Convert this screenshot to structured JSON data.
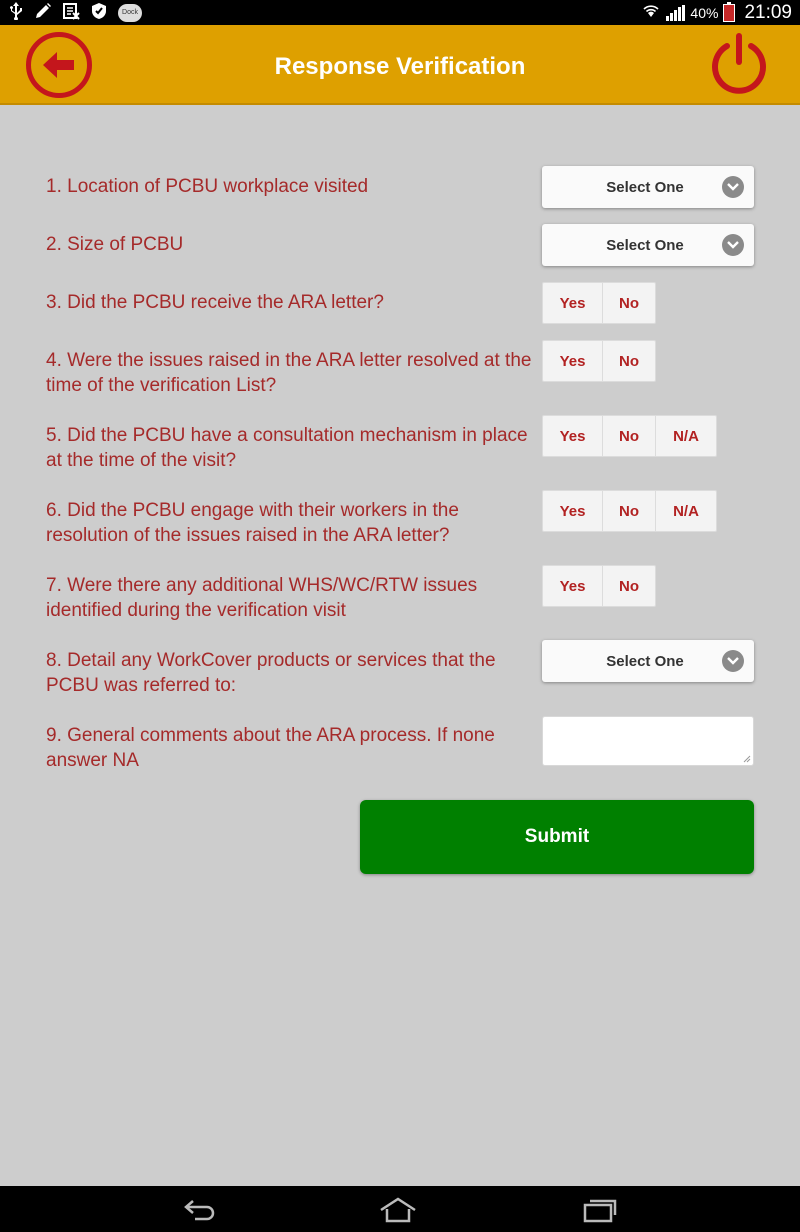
{
  "status_bar": {
    "left_icons": [
      "usb-icon",
      "pencil-icon",
      "sim-icon",
      "shield-icon",
      "app-badge-icon"
    ],
    "app_badge_text": "Dock",
    "battery_percent": "40%",
    "time": "21:09"
  },
  "header": {
    "title": "Response Verification",
    "back_icon": "back-arrow-icon",
    "power_icon": "power-icon",
    "accent_color": "#dea000",
    "icon_color": "#c4161c"
  },
  "form": {
    "questions": [
      {
        "number": 1,
        "text": "1. Location of PCBU workplace visited",
        "control": "select",
        "value": "Select One"
      },
      {
        "number": 2,
        "text": "2. Size of PCBU",
        "control": "select",
        "value": "Select One"
      },
      {
        "number": 3,
        "text": "3. Did the PCBU receive the ARA letter?",
        "control": "buttons",
        "options": [
          "Yes",
          "No"
        ]
      },
      {
        "number": 4,
        "text": "4. Were the issues raised in the ARA letter resolved at the time of the verification List?",
        "control": "buttons",
        "options": [
          "Yes",
          "No"
        ]
      },
      {
        "number": 5,
        "text": "5. Did the PCBU have a consultation mechanism in place at the time of the visit?",
        "control": "buttons",
        "options": [
          "Yes",
          "No",
          "N/A"
        ]
      },
      {
        "number": 6,
        "text": "6. Did the PCBU engage with their workers in the resolution of the issues raised in the ARA letter?",
        "control": "buttons",
        "options": [
          "Yes",
          "No",
          "N/A"
        ]
      },
      {
        "number": 7,
        "text": "7. Were there any additional WHS/WC/RTW issues identified during the verification visit",
        "control": "buttons",
        "options": [
          "Yes",
          "No"
        ]
      },
      {
        "number": 8,
        "text": "8. Detail any WorkCover products or services that the PCBU was referred to:",
        "control": "select",
        "value": "Select One"
      },
      {
        "number": 9,
        "text": "9. General comments about the ARA process. If none answer NA",
        "control": "textarea",
        "value": ""
      }
    ],
    "submit_label": "Submit",
    "submit_color": "#008000",
    "question_text_color": "#a52a2a"
  },
  "nav_bar": {
    "icons": [
      "back-nav-icon",
      "home-nav-icon",
      "recents-nav-icon"
    ]
  }
}
